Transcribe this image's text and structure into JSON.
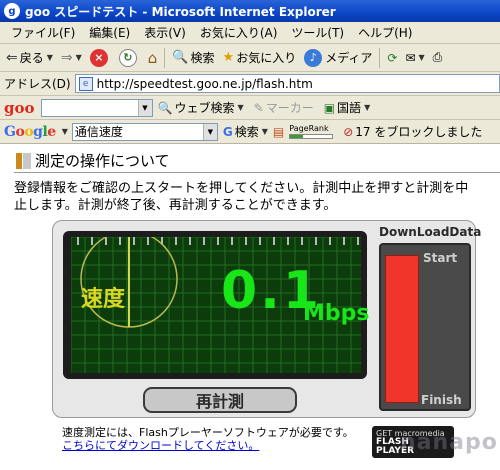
{
  "window": {
    "title": "goo スピードテスト - Microsoft Internet Explorer",
    "app_icon": "goo"
  },
  "menu": [
    "ファイル(F)",
    "編集(E)",
    "表示(V)",
    "お気に入り(A)",
    "ツール(T)",
    "ヘルプ(H)"
  ],
  "toolbar": {
    "back": "戻る",
    "search": "検索",
    "favorites": "お気に入り",
    "media": "メディア"
  },
  "address": {
    "label": "アドレス(D)",
    "url": "http://speedtest.goo.ne.jp/flash.htm"
  },
  "goo_toolbar": {
    "logo": "goo",
    "web_search": "ウェブ検索",
    "marker": "マーカー",
    "dictionary": "国語"
  },
  "google_toolbar": {
    "logo": "Google",
    "query": "通信速度",
    "search": "検索",
    "pagerank_label": "PageRank",
    "pagerank_fraction": 0.3,
    "popup_blocked": "17 をブロックしました"
  },
  "page": {
    "heading": "測定の操作について",
    "intro_line1": "登録情報をご確認の上スタートを押してください。計測中止を押すと計測を中",
    "intro_line2": "止します。計測が終了後、再計測することができます。"
  },
  "speedtest": {
    "speed_label": "速度",
    "speed_value": "0.1",
    "speed_unit": "Mbps",
    "remeasure_button": "再計測",
    "download_title": "DownLoadData",
    "start_label": "Start",
    "finish_label": "Finish",
    "progress_fraction": 0.0
  },
  "footnote": {
    "line1": "速度測定には、Flashプレーヤーソフトウェアが必要です。",
    "link": "こちらにてダウンロードしてください。"
  },
  "flash_badge": {
    "line1": "GET macromedia",
    "line2": "FLASH",
    "line3": "PLAYER"
  },
  "watermark": "nanapo.net",
  "colors": {
    "meter_grid": "#1f6e1f",
    "speed_text": "#19e619",
    "label_text": "#d8d820",
    "download_bar": "#f0352b"
  }
}
